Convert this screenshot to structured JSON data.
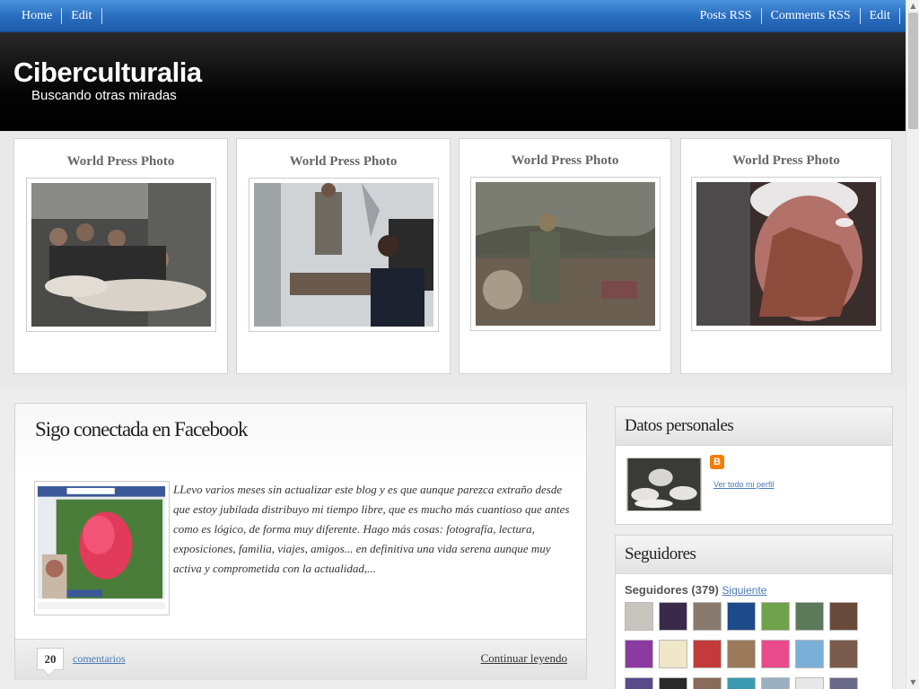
{
  "nav": {
    "left": [
      "Home",
      "Edit"
    ],
    "right": [
      "Posts RSS",
      "Comments RSS",
      "Edit"
    ]
  },
  "header": {
    "title": "Ciberculturalia",
    "description": "Buscando otras miradas"
  },
  "featured": [
    {
      "title": "World Press Photo"
    },
    {
      "title": "World Press Photo"
    },
    {
      "title": "World Press Photo"
    },
    {
      "title": "World Press Photo"
    }
  ],
  "post": {
    "title": "Sigo conectada en Facebook",
    "excerpt": "LLevo varios meses sin actualizar este blog y es que aunque parezca extraño desde que estoy jubilada distribuyo mi tiempo libre, que es mucho más cuantioso que antes como es lógico, de forma muy diferente. Hago más cosas: fotografía, lectura, exposiciones, familia, viajes, amigos... en definitiva una vida serena aunque muy activa y comprometida con la actualidad,...",
    "comment_count": "20",
    "comments_label": "comentarios",
    "read_more": "Continuar leyendo"
  },
  "sidebar": {
    "profile": {
      "heading": "Datos personales",
      "profile_link": "Ver todo mi perfil",
      "blogger_icon_glyph": "B"
    },
    "followers": {
      "heading": "Seguidores",
      "label": "Seguidores",
      "count": "(379)",
      "follow_link": "Siguiente"
    }
  },
  "colors": {
    "nav_bar": "#2a6fc0",
    "header_bg": "#000000",
    "link": "#4a7ab8",
    "blogger": "#f57d00"
  }
}
